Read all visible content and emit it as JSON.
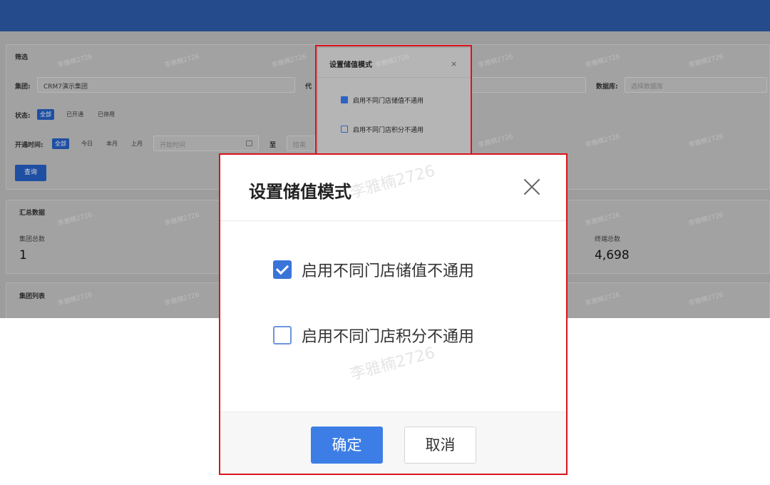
{
  "background": {
    "filter": {
      "title": "筛选",
      "group_label": "集团:",
      "group_value": "CRM7演示集团",
      "agent_label": "代",
      "db_label": "数据库:",
      "db_placeholder": "选择数据库",
      "status_label": "状态:",
      "status_options": [
        "全部",
        "已开通",
        "已停用"
      ],
      "open_time_label": "开通时间:",
      "time_options": [
        "全部",
        "今日",
        "本月",
        "上月"
      ],
      "start_placeholder": "开始时间",
      "range_sep": "至",
      "end_placeholder": "结束",
      "query_button": "查询"
    },
    "summary": {
      "title": "汇总数据",
      "group_count_label": "集团总数",
      "group_count_value": "1",
      "terminal_count_label": "终端总数",
      "terminal_count_value": "4,698"
    },
    "list": {
      "title": "集团列表"
    },
    "mini_dialog": {
      "title": "设置储值模式",
      "close": "×",
      "option1": "启用不同门店储值不通用",
      "option2": "启用不同门店积分不通用"
    },
    "watermark": "李雅楠2726"
  },
  "dialog": {
    "title": "设置储值模式",
    "options": [
      {
        "label": "启用不同门店储值不通用",
        "checked": true
      },
      {
        "label": "启用不同门店积分不通用",
        "checked": false
      }
    ],
    "ok_button": "确定",
    "cancel_button": "取消",
    "watermark": "李雅楠2726"
  },
  "colors": {
    "header": "#254b8c",
    "primary": "#3d7ee6",
    "highlight_border": "#d9141b"
  }
}
